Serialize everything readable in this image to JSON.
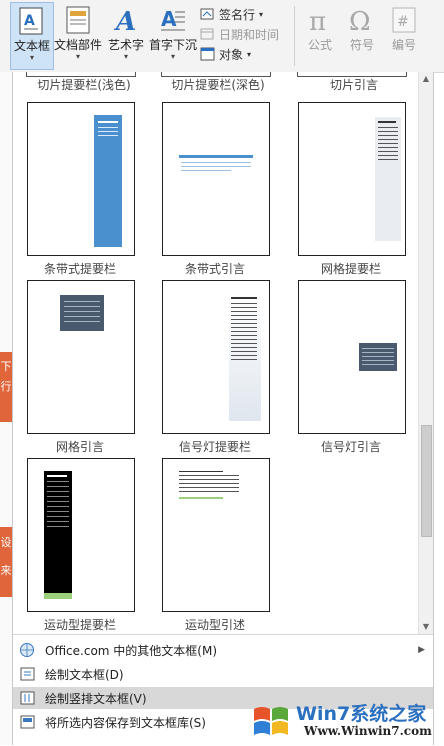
{
  "ribbon": {
    "buttons": [
      {
        "label": "文本框",
        "active": true
      },
      {
        "label": "文档部件"
      },
      {
        "label": "艺术字"
      },
      {
        "label": "首字下沉"
      }
    ],
    "small": [
      {
        "label": "签名行"
      },
      {
        "label": "日期和时间"
      },
      {
        "label": "对象"
      }
    ],
    "symbols": [
      {
        "label": "公式"
      },
      {
        "label": "符号"
      },
      {
        "label": "编号"
      }
    ]
  },
  "gallery": {
    "top_labels": [
      "切片提要栏(浅色)",
      "切片提要栏(深色)",
      "切片引言"
    ],
    "items": [
      {
        "caption": "条带式提要栏"
      },
      {
        "caption": "条带式引言"
      },
      {
        "caption": "网格提要栏"
      },
      {
        "caption": "网格引言"
      },
      {
        "caption": "信号灯提要栏"
      },
      {
        "caption": "信号灯引言"
      },
      {
        "caption": "运动型提要栏"
      },
      {
        "caption": "运动型引述"
      }
    ],
    "scroll_position": 0.8
  },
  "menu": {
    "items": [
      {
        "label": "Office.com 中的其他文本框(M)"
      },
      {
        "label": "绘制文本框(D)"
      },
      {
        "label": "绘制竖排文本框(V)"
      },
      {
        "label": "将所选内容保存到文本框库(S)"
      }
    ]
  },
  "left_scraps": [
    "下",
    "行",
    "设",
    "来"
  ],
  "watermark": {
    "brand": "Win7系统之家",
    "url": "Www.Winwin7.com"
  },
  "colors": {
    "accent_blue": "#4a90cf",
    "slate": "#4a5a6e",
    "sport_green": "#9bd17a",
    "highlight": "#cfe3f7"
  }
}
